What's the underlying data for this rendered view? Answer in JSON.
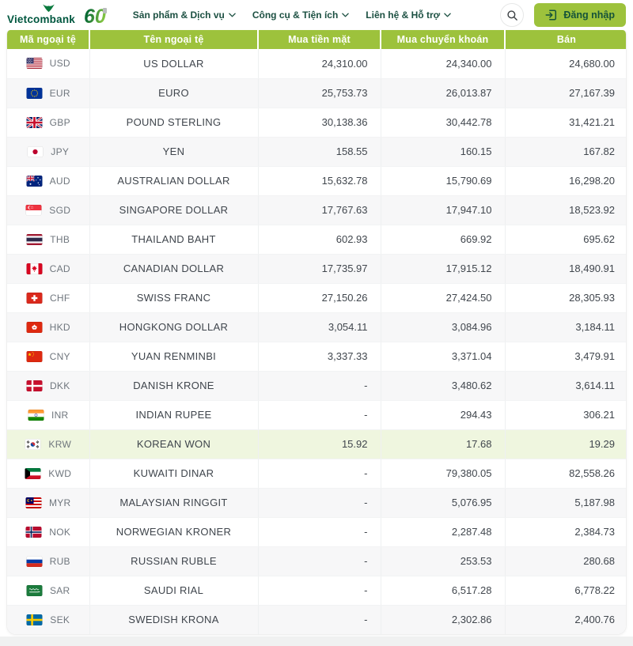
{
  "brand": {
    "wordmark": "Vietcombank",
    "anniversary": "60"
  },
  "nav": {
    "items": [
      {
        "label": "Sản phẩm & Dịch vụ"
      },
      {
        "label": "Công cụ & Tiện ích"
      },
      {
        "label": "Liên hệ & Hỗ trợ"
      }
    ]
  },
  "actions": {
    "login_label": "Đăng nhập"
  },
  "colors": {
    "accent_lime": "#9DC23C",
    "brand_green": "#00573F",
    "login_text": "#155339",
    "row_stripe": "#F7F7F8",
    "row_highlight": "#EFF6DF"
  },
  "table": {
    "columns": [
      "Mã ngoại tệ",
      "Tên ngoại tệ",
      "Mua tiền mặt",
      "Mua chuyển khoán",
      "Bán"
    ],
    "rows": [
      {
        "code": "USD",
        "name": "US DOLLAR",
        "cash": "24,310.00",
        "transfer": "24,340.00",
        "sell": "24,680.00",
        "highlight": false
      },
      {
        "code": "EUR",
        "name": "EURO",
        "cash": "25,753.73",
        "transfer": "26,013.87",
        "sell": "27,167.39",
        "highlight": false
      },
      {
        "code": "GBP",
        "name": "POUND STERLING",
        "cash": "30,138.36",
        "transfer": "30,442.78",
        "sell": "31,421.21",
        "highlight": false
      },
      {
        "code": "JPY",
        "name": "YEN",
        "cash": "158.55",
        "transfer": "160.15",
        "sell": "167.82",
        "highlight": false
      },
      {
        "code": "AUD",
        "name": "AUSTRALIAN DOLLAR",
        "cash": "15,632.78",
        "transfer": "15,790.69",
        "sell": "16,298.20",
        "highlight": false
      },
      {
        "code": "SGD",
        "name": "SINGAPORE DOLLAR",
        "cash": "17,767.63",
        "transfer": "17,947.10",
        "sell": "18,523.92",
        "highlight": false
      },
      {
        "code": "THB",
        "name": "THAILAND BAHT",
        "cash": "602.93",
        "transfer": "669.92",
        "sell": "695.62",
        "highlight": false
      },
      {
        "code": "CAD",
        "name": "CANADIAN DOLLAR",
        "cash": "17,735.97",
        "transfer": "17,915.12",
        "sell": "18,490.91",
        "highlight": false
      },
      {
        "code": "CHF",
        "name": "SWISS FRANC",
        "cash": "27,150.26",
        "transfer": "27,424.50",
        "sell": "28,305.93",
        "highlight": false
      },
      {
        "code": "HKD",
        "name": "HONGKONG DOLLAR",
        "cash": "3,054.11",
        "transfer": "3,084.96",
        "sell": "3,184.11",
        "highlight": false
      },
      {
        "code": "CNY",
        "name": "YUAN RENMINBI",
        "cash": "3,337.33",
        "transfer": "3,371.04",
        "sell": "3,479.91",
        "highlight": false
      },
      {
        "code": "DKK",
        "name": "DANISH KRONE",
        "cash": "-",
        "transfer": "3,480.62",
        "sell": "3,614.11",
        "highlight": false
      },
      {
        "code": "INR",
        "name": "INDIAN RUPEE",
        "cash": "-",
        "transfer": "294.43",
        "sell": "306.21",
        "highlight": false
      },
      {
        "code": "KRW",
        "name": "KOREAN WON",
        "cash": "15.92",
        "transfer": "17.68",
        "sell": "19.29",
        "highlight": true
      },
      {
        "code": "KWD",
        "name": "KUWAITI DINAR",
        "cash": "-",
        "transfer": "79,380.05",
        "sell": "82,558.26",
        "highlight": false
      },
      {
        "code": "MYR",
        "name": "MALAYSIAN RINGGIT",
        "cash": "-",
        "transfer": "5,076.95",
        "sell": "5,187.98",
        "highlight": false
      },
      {
        "code": "NOK",
        "name": "NORWEGIAN KRONER",
        "cash": "-",
        "transfer": "2,287.48",
        "sell": "2,384.73",
        "highlight": false
      },
      {
        "code": "RUB",
        "name": "RUSSIAN RUBLE",
        "cash": "-",
        "transfer": "253.53",
        "sell": "280.68",
        "highlight": false
      },
      {
        "code": "SAR",
        "name": "SAUDI RIAL",
        "cash": "-",
        "transfer": "6,517.28",
        "sell": "6,778.22",
        "highlight": false
      },
      {
        "code": "SEK",
        "name": "SWEDISH KRONA",
        "cash": "-",
        "transfer": "2,302.86",
        "sell": "2,400.76",
        "highlight": false
      }
    ]
  }
}
